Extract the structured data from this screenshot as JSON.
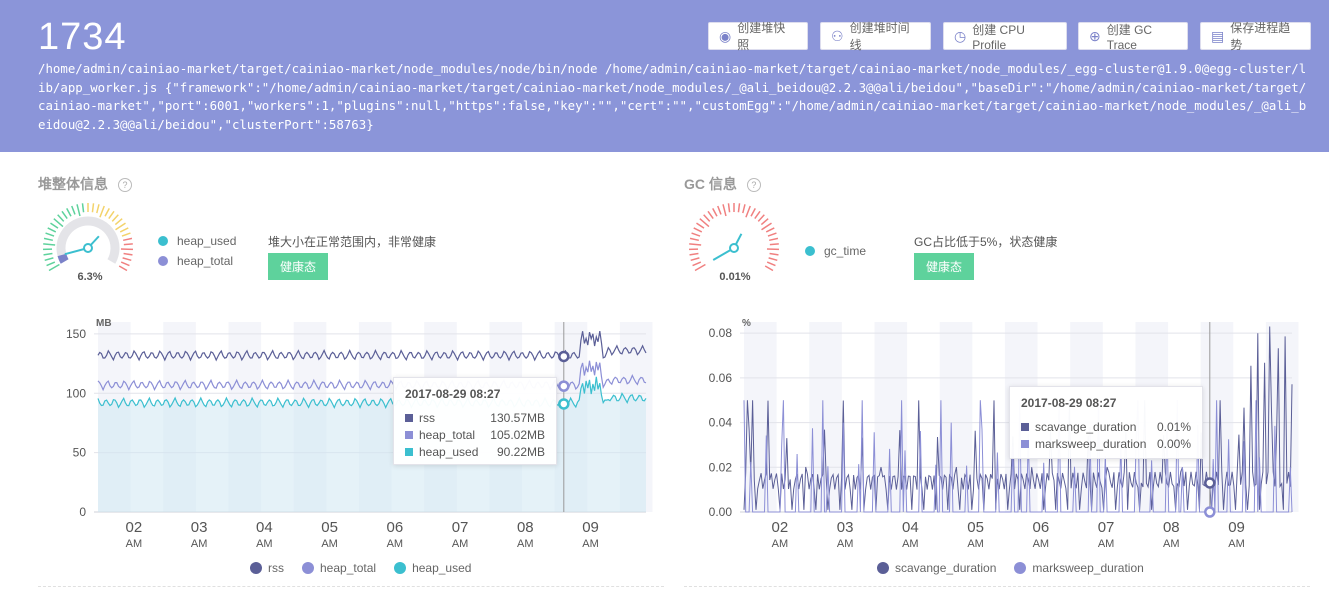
{
  "header": {
    "pid": "1734",
    "command": "/home/admin/cainiao-market/target/cainiao-market/node_modules/node/bin/node /home/admin/cainiao-market/target/cainiao-market/node_modules/_egg-cluster@1.9.0@egg-cluster/lib/app_worker.js {\"framework\":\"/home/admin/cainiao-market/target/cainiao-market/node_modules/_@ali_beidou@2.2.3@@ali/beidou\",\"baseDir\":\"/home/admin/cainiao-market/target/cainiao-market\",\"port\":6001,\"workers\":1,\"plugins\":null,\"https\":false,\"key\":\"\",\"cert\":\"\",\"customEgg\":\"/home/admin/cainiao-market/target/cainiao-market/node_modules/_@ali_beidou@2.2.3@@ali/beidou\",\"clusterPort\":58763}",
    "buttons": [
      {
        "label": "创建堆快照",
        "icon": "camera-icon"
      },
      {
        "label": "创建堆时间线",
        "icon": "timeline-icon"
      },
      {
        "label": "创建 CPU Profile",
        "icon": "stopwatch-icon"
      },
      {
        "label": "创建 GC Trace",
        "icon": "crosshair-icon"
      },
      {
        "label": "保存进程趋势",
        "icon": "document-icon"
      }
    ]
  },
  "heap": {
    "title": "堆整体信息",
    "gauge_value": "6.3%",
    "gauge_fraction": 0.063,
    "legend": [
      "heap_used",
      "heap_total"
    ],
    "status_text": "堆大小在正常范围内，非常健康",
    "badge": "健康态",
    "tooltip": {
      "title": "2017-08-29 08:27",
      "rows": [
        {
          "name": "rss",
          "value": "130.57MB",
          "color": "#5b5f97"
        },
        {
          "name": "heap_total",
          "value": "105.02MB",
          "color": "#8c8fd6"
        },
        {
          "name": "heap_used",
          "value": "90.22MB",
          "color": "#3bbfcf"
        }
      ]
    },
    "bottom_legend": [
      {
        "name": "rss",
        "color": "#5b5f97"
      },
      {
        "name": "heap_total",
        "color": "#8c8fd6"
      },
      {
        "name": "heap_used",
        "color": "#3bbfcf"
      }
    ]
  },
  "gc": {
    "title": "GC 信息",
    "gauge_value": "0.01%",
    "gauge_fraction": 0.0001,
    "legend": [
      "gc_time"
    ],
    "status_text": "GC占比低于5%，状态健康",
    "badge": "健康态",
    "tooltip": {
      "title": "2017-08-29 08:27",
      "rows": [
        {
          "name": "scavange_duration",
          "value": "0.01%",
          "color": "#5b5f97"
        },
        {
          "name": "marksweep_duration",
          "value": "0.00%",
          "color": "#8c8fd6"
        }
      ]
    },
    "bottom_legend": [
      {
        "name": "scavange_duration",
        "color": "#5b5f97"
      },
      {
        "name": "marksweep_duration",
        "color": "#8c8fd6"
      }
    ]
  },
  "chart_data": [
    {
      "type": "line",
      "ylabel": "MB",
      "ylim": [
        0,
        160
      ],
      "yticks": [
        0,
        50,
        100,
        150
      ],
      "x_ticks": [
        "02",
        "03",
        "04",
        "05",
        "06",
        "07",
        "08",
        "09"
      ],
      "x_tick_sub": "AM",
      "series": [
        {
          "name": "rss",
          "color": "#5b5f97",
          "base": 132,
          "amp": 4
        },
        {
          "name": "heap_total",
          "color": "#8c8fd6",
          "base": 107,
          "amp": 4
        },
        {
          "name": "heap_used",
          "color": "#3bbfcf",
          "base": 92,
          "amp": 4
        }
      ],
      "grid": true,
      "legend": "bottom"
    },
    {
      "type": "line",
      "ylabel": "%",
      "ylim": [
        0,
        0.085
      ],
      "yticks": [
        "0.00",
        "0.02",
        "0.04",
        "0.06",
        "0.08"
      ],
      "x_ticks": [
        "02",
        "03",
        "04",
        "05",
        "06",
        "07",
        "08",
        "09"
      ],
      "x_tick_sub": "AM",
      "series": [
        {
          "name": "scavange_duration",
          "color": "#5b5f97",
          "base": 0.014
        },
        {
          "name": "marksweep_duration",
          "color": "#8c8fd6",
          "base": 0.0
        }
      ],
      "grid": true,
      "legend": "bottom"
    }
  ]
}
